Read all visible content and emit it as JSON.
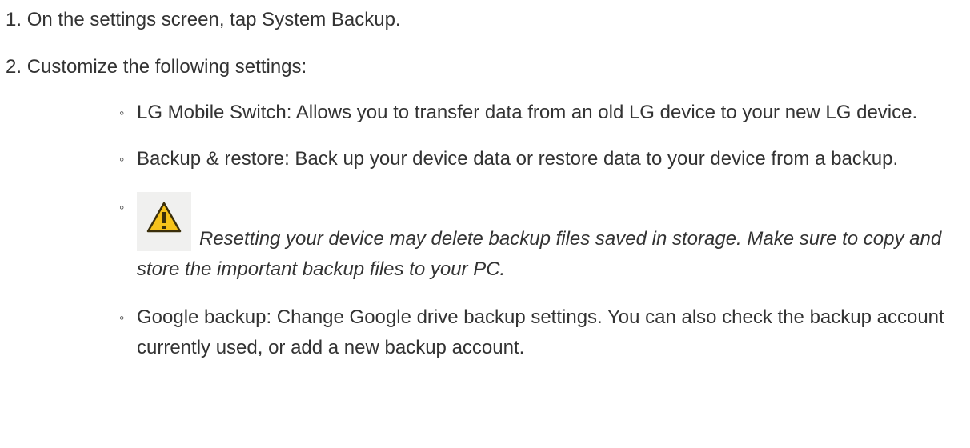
{
  "steps": [
    {
      "number": "1.",
      "text": "On the settings screen, tap System Backup."
    },
    {
      "number": "2.",
      "text": "Customize the following settings:"
    }
  ],
  "sub_items": [
    {
      "bullet": "◦",
      "text": "LG Mobile Switch: Allows you to transfer data from an old LG device to your new LG device."
    },
    {
      "bullet": "◦",
      "text": "Backup & restore: Back up your device data or restore data to your device from a backup."
    },
    {
      "bullet": "◦",
      "icon": "warning-icon",
      "text": "Resetting your device may delete backup files saved in storage. Make sure to copy and store the important backup files to your PC."
    },
    {
      "bullet": "◦",
      "text": "Google backup: Change Google drive backup settings. You can also check the backup account currently used, or add a new backup account."
    }
  ],
  "colors": {
    "text": "#333333",
    "warning_fill": "#f6c21a",
    "warning_stroke": "#3a2e0a",
    "icon_background": "#f0f0ef"
  }
}
